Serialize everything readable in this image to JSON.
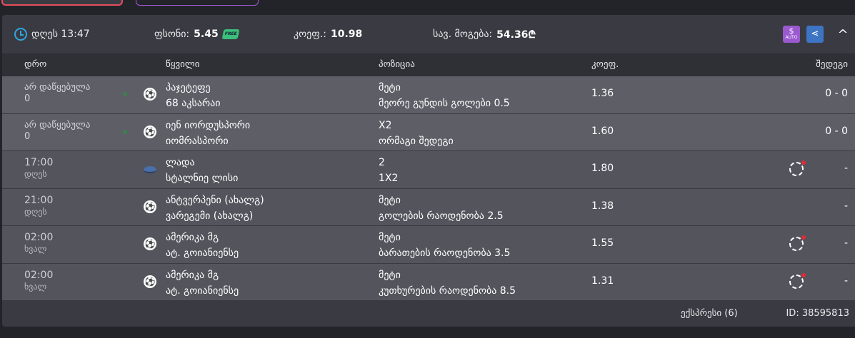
{
  "header": {
    "time_label": "დღეს 13:47",
    "stake_label": "ფსონი:",
    "stake_value": "5.45",
    "free_icon": "FREE",
    "odds_label": "კოეფ.:",
    "odds_value": "10.98",
    "win_label": "სავ. მოგება:",
    "win_value": "54.36₾",
    "auto_label": "AUTO",
    "auto_symbol": "$",
    "share_symbol": "⋖",
    "collapse_symbol": "^"
  },
  "columns": {
    "time": "დრო",
    "event": "წყვილი",
    "position": "პოზიცია",
    "odds": "კოეფ.",
    "result": "შედეგი"
  },
  "rows": [
    {
      "time1": "არ დაწყებულა",
      "time2": "0",
      "sport": "soccer",
      "team1": "პაჯეტეფე",
      "team2": "68 აკსარაი",
      "pick": "მეტი",
      "market": "მეორე გუნდის გოლები 0.5",
      "odd": "1.36",
      "result": "0 - 0",
      "live": true,
      "pending": false
    },
    {
      "time1": "არ დაწყებულა",
      "time2": "0",
      "sport": "soccer",
      "team1": "იენ იორდუსპორი",
      "team2": "იომრასპორი",
      "pick": "X2",
      "market": "ორმაგი შედეგი",
      "odd": "1.60",
      "result": "0 - 0",
      "live": true,
      "pending": false
    },
    {
      "time1": "17:00",
      "time2": "დღეს",
      "sport": "hockey",
      "team1": "ლადა",
      "team2": "სტალნიე ლისი",
      "pick": "2",
      "market": "1X2",
      "odd": "1.80",
      "result": "-",
      "live": false,
      "pending": true
    },
    {
      "time1": "21:00",
      "time2": "დღეს",
      "sport": "soccer",
      "team1": "ანტვერპენი (ახალგ)",
      "team2": "ვარეგემი (ახალგ)",
      "pick": "მეტი",
      "market": "გოლების რაოდენობა 2.5",
      "odd": "1.38",
      "result": "-",
      "live": false,
      "pending": false
    },
    {
      "time1": "02:00",
      "time2": "ხვალ",
      "sport": "soccer",
      "team1": "ამერიკა მგ",
      "team2": "ატ. გოიანიენსე",
      "pick": "მეტი",
      "market": "ბარათების რაოდენობა 3.5",
      "odd": "1.55",
      "result": "-",
      "live": false,
      "pending": true
    },
    {
      "time1": "02:00",
      "time2": "ხვალ",
      "sport": "soccer",
      "team1": "ამერიკა მგ",
      "team2": "ატ. გოიანიენსე",
      "pick": "მეტი",
      "market": "კუთხურების რაოდენობა 8.5",
      "odd": "1.31",
      "result": "-",
      "live": false,
      "pending": true
    }
  ],
  "footer": {
    "express": "ექსპრესი (6)",
    "id": "ID: 38595813"
  }
}
